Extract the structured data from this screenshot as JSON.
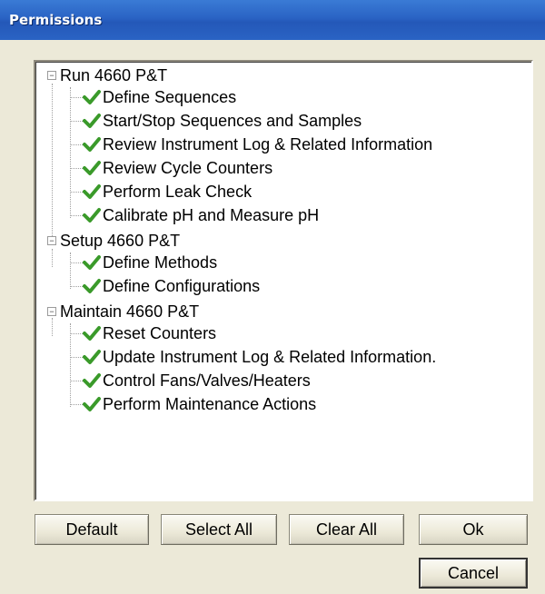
{
  "window": {
    "title": "Permissions"
  },
  "tree": {
    "groups": [
      {
        "label": "Run 4660 P&T",
        "items": [
          "Define Sequences",
          "Start/Stop Sequences and Samples",
          "Review Instrument Log & Related Information",
          "Review Cycle Counters",
          "Perform Leak Check",
          "Calibrate pH and Measure pH"
        ]
      },
      {
        "label": "Setup 4660 P&T",
        "items": [
          "Define Methods",
          "Define Configurations"
        ]
      },
      {
        "label": "Maintain 4660 P&T",
        "items": [
          "Reset Counters",
          "Update Instrument Log & Related Information.",
          "Control Fans/Valves/Heaters",
          "Perform Maintenance Actions"
        ]
      }
    ]
  },
  "buttons": {
    "default": "Default",
    "select_all": "Select All",
    "clear_all": "Clear All",
    "ok": "Ok",
    "cancel": "Cancel"
  },
  "icons": {
    "check": "green-checkmark-icon",
    "expander": "minus-icon"
  },
  "colors": {
    "title_bar": "#2a63c4",
    "check": "#3a9a2a",
    "dialog_bg": "#ece9d8"
  }
}
